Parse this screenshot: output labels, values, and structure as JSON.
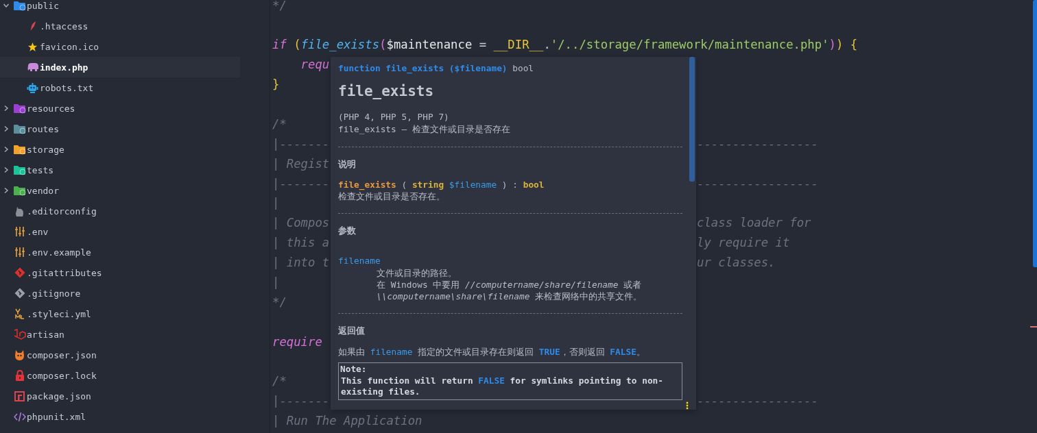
{
  "sidebar": {
    "tree": [
      {
        "label": "public",
        "expanded": true,
        "selected": false,
        "children": [
          {
            "label": ".htaccess",
            "selected": false
          },
          {
            "label": "favicon.ico",
            "selected": false
          },
          {
            "label": "index.php",
            "selected": true
          },
          {
            "label": "robots.txt",
            "selected": false
          }
        ]
      },
      {
        "label": "resources",
        "expanded": false,
        "selected": false
      },
      {
        "label": "routes",
        "expanded": false,
        "selected": false
      },
      {
        "label": "storage",
        "expanded": false,
        "selected": false
      },
      {
        "label": "tests",
        "expanded": false,
        "selected": false
      },
      {
        "label": "vendor",
        "expanded": false,
        "selected": false
      },
      {
        "label": ".editorconfig",
        "selected": false
      },
      {
        "label": ".env",
        "selected": false
      },
      {
        "label": ".env.example",
        "selected": false
      },
      {
        "label": ".gitattributes",
        "selected": false
      },
      {
        "label": ".gitignore",
        "selected": false
      },
      {
        "label": ".styleci.yml",
        "selected": false
      },
      {
        "label": "artisan",
        "selected": false
      },
      {
        "label": "composer.json",
        "selected": false
      },
      {
        "label": "composer.lock",
        "selected": false
      },
      {
        "label": "package.json",
        "selected": false
      },
      {
        "label": "phpunit.xml",
        "selected": false
      }
    ]
  },
  "editor": {
    "lines": [
      {
        "kind": "code",
        "tokens": [
          {
            "kind": "comment",
            "text": "*/"
          }
        ]
      },
      {
        "kind": "blank"
      },
      {
        "kind": "code",
        "tokens": [
          {
            "kind": "keyword",
            "text": "if"
          },
          {
            "kind": "paren",
            "text": " ("
          },
          {
            "kind": "func",
            "text": "file_exists"
          },
          {
            "kind": "paren2",
            "text": "("
          },
          {
            "kind": "var",
            "text": "$maintenance"
          },
          {
            "kind": "op",
            "text": " = "
          },
          {
            "kind": "const",
            "text": "__DIR__"
          },
          {
            "kind": "op",
            "text": "."
          },
          {
            "kind": "string",
            "text": "'/../storage/framework/maintenance.php'"
          },
          {
            "kind": "paren2",
            "text": ")"
          },
          {
            "kind": "paren",
            "text": ")"
          },
          {
            "kind": "paren",
            "text": " {"
          }
        ]
      },
      {
        "kind": "code",
        "tokens": [
          {
            "kind": "keyword",
            "text": "    requ"
          }
        ]
      },
      {
        "kind": "code",
        "tokens": [
          {
            "kind": "paren",
            "text": "}"
          }
        ]
      },
      {
        "kind": "blank"
      },
      {
        "kind": "code",
        "tokens": [
          {
            "kind": "comment",
            "text": "/*"
          }
        ]
      },
      {
        "kind": "code",
        "tokens": [
          {
            "kind": "comment",
            "text": "|-------"
          }
        ],
        "right": "-----------------"
      },
      {
        "kind": "code",
        "tokens": [
          {
            "kind": "comment",
            "text": "| Regist"
          }
        ]
      },
      {
        "kind": "code",
        "tokens": [
          {
            "kind": "comment",
            "text": "|-------"
          }
        ],
        "right": "-----------------"
      },
      {
        "kind": "code",
        "tokens": [
          {
            "kind": "comment",
            "text": "|"
          }
        ]
      },
      {
        "kind": "code",
        "tokens": [
          {
            "kind": "comment",
            "text": "| Compos"
          }
        ],
        "right": "class loader for"
      },
      {
        "kind": "code",
        "tokens": [
          {
            "kind": "comment",
            "text": "| this a"
          }
        ],
        "right": "ly require it"
      },
      {
        "kind": "code",
        "tokens": [
          {
            "kind": "comment",
            "text": "| into t"
          }
        ],
        "right": "ur classes."
      },
      {
        "kind": "code",
        "tokens": [
          {
            "kind": "comment",
            "text": "|"
          }
        ]
      },
      {
        "kind": "code",
        "tokens": [
          {
            "kind": "comment",
            "text": "*/"
          }
        ]
      },
      {
        "kind": "blank"
      },
      {
        "kind": "code",
        "tokens": [
          {
            "kind": "keyword",
            "text": "require"
          }
        ]
      },
      {
        "kind": "blank"
      },
      {
        "kind": "code",
        "tokens": [
          {
            "kind": "comment",
            "text": "/*"
          }
        ]
      },
      {
        "kind": "code",
        "tokens": [
          {
            "kind": "comment",
            "text": "|-------"
          }
        ],
        "right": "-----------------"
      },
      {
        "kind": "code",
        "tokens": [
          {
            "kind": "comment",
            "text": "| Run The Application"
          }
        ]
      }
    ]
  },
  "popup": {
    "signature": [
      {
        "kind": "kw",
        "text": "function file_exists ($filename)"
      },
      {
        "kind": "plain",
        "text": " bool"
      }
    ],
    "title": "file_exists",
    "versions": "(PHP 4, PHP 5, PHP 7)",
    "summary": "file_exists — 检查文件或目录是否存在",
    "sections": [
      {
        "kind": "description",
        "heading": "说明",
        "synopsis": [
          {
            "kind": "name",
            "text": "file_exists"
          },
          {
            "kind": "plain",
            "text": " ( "
          },
          {
            "kind": "type",
            "text": "string "
          },
          {
            "kind": "var",
            "text": "$filename"
          },
          {
            "kind": "plain",
            "text": " ) : "
          },
          {
            "kind": "type",
            "text": "bool"
          }
        ],
        "text": "检查文件或目录是否存在。"
      },
      {
        "kind": "parameters",
        "heading": "参数",
        "params": [
          {
            "name": "filename",
            "lines": [
              "文件或目录的路径。",
              "在 Windows 中要用 *//computername/share/filename* 或者 *\\\\computername\\share\\filename* 来检查网络中的共享文件。"
            ]
          }
        ]
      },
      {
        "kind": "return",
        "heading": "返回值",
        "text": [
          {
            "kind": "plain",
            "text": "如果由 "
          },
          {
            "kind": "var",
            "text": "filename"
          },
          {
            "kind": "plain",
            "text": " 指定的文件或目录存在则返回 "
          },
          {
            "kind": "const",
            "text": "TRUE"
          },
          {
            "kind": "plain",
            "text": "，否则返回 "
          },
          {
            "kind": "const",
            "text": "FALSE"
          },
          {
            "kind": "plain",
            "text": "。"
          }
        ],
        "note": {
          "title": "Note:",
          "text": [
            {
              "kind": "plain",
              "text": "This function will return "
            },
            {
              "kind": "const",
              "text": "FALSE"
            },
            {
              "kind": "plain",
              "text": " for symlinks pointing to non-existing files."
            }
          ]
        }
      }
    ]
  }
}
